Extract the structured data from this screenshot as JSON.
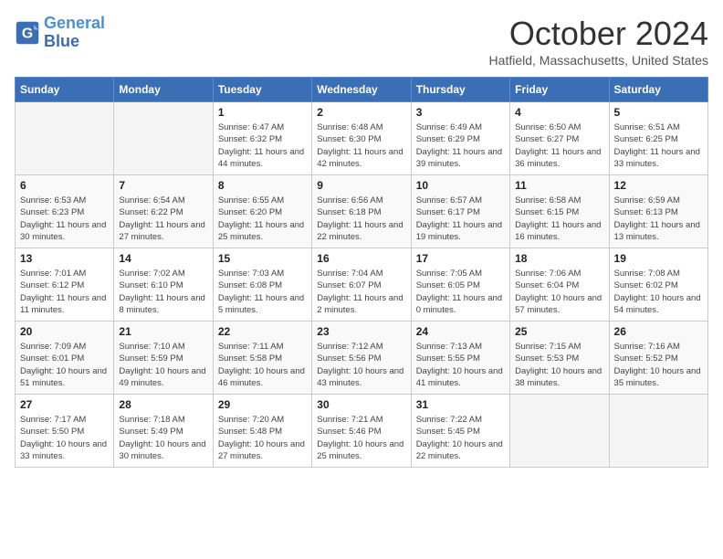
{
  "logo": {
    "line1": "General",
    "line2": "Blue"
  },
  "title": "October 2024",
  "location": "Hatfield, Massachusetts, United States",
  "weekdays": [
    "Sunday",
    "Monday",
    "Tuesday",
    "Wednesday",
    "Thursday",
    "Friday",
    "Saturday"
  ],
  "weeks": [
    [
      {
        "day": "",
        "content": ""
      },
      {
        "day": "",
        "content": ""
      },
      {
        "day": "1",
        "content": "Sunrise: 6:47 AM\nSunset: 6:32 PM\nDaylight: 11 hours and 44 minutes."
      },
      {
        "day": "2",
        "content": "Sunrise: 6:48 AM\nSunset: 6:30 PM\nDaylight: 11 hours and 42 minutes."
      },
      {
        "day": "3",
        "content": "Sunrise: 6:49 AM\nSunset: 6:29 PM\nDaylight: 11 hours and 39 minutes."
      },
      {
        "day": "4",
        "content": "Sunrise: 6:50 AM\nSunset: 6:27 PM\nDaylight: 11 hours and 36 minutes."
      },
      {
        "day": "5",
        "content": "Sunrise: 6:51 AM\nSunset: 6:25 PM\nDaylight: 11 hours and 33 minutes."
      }
    ],
    [
      {
        "day": "6",
        "content": "Sunrise: 6:53 AM\nSunset: 6:23 PM\nDaylight: 11 hours and 30 minutes."
      },
      {
        "day": "7",
        "content": "Sunrise: 6:54 AM\nSunset: 6:22 PM\nDaylight: 11 hours and 27 minutes."
      },
      {
        "day": "8",
        "content": "Sunrise: 6:55 AM\nSunset: 6:20 PM\nDaylight: 11 hours and 25 minutes."
      },
      {
        "day": "9",
        "content": "Sunrise: 6:56 AM\nSunset: 6:18 PM\nDaylight: 11 hours and 22 minutes."
      },
      {
        "day": "10",
        "content": "Sunrise: 6:57 AM\nSunset: 6:17 PM\nDaylight: 11 hours and 19 minutes."
      },
      {
        "day": "11",
        "content": "Sunrise: 6:58 AM\nSunset: 6:15 PM\nDaylight: 11 hours and 16 minutes."
      },
      {
        "day": "12",
        "content": "Sunrise: 6:59 AM\nSunset: 6:13 PM\nDaylight: 11 hours and 13 minutes."
      }
    ],
    [
      {
        "day": "13",
        "content": "Sunrise: 7:01 AM\nSunset: 6:12 PM\nDaylight: 11 hours and 11 minutes."
      },
      {
        "day": "14",
        "content": "Sunrise: 7:02 AM\nSunset: 6:10 PM\nDaylight: 11 hours and 8 minutes."
      },
      {
        "day": "15",
        "content": "Sunrise: 7:03 AM\nSunset: 6:08 PM\nDaylight: 11 hours and 5 minutes."
      },
      {
        "day": "16",
        "content": "Sunrise: 7:04 AM\nSunset: 6:07 PM\nDaylight: 11 hours and 2 minutes."
      },
      {
        "day": "17",
        "content": "Sunrise: 7:05 AM\nSunset: 6:05 PM\nDaylight: 11 hours and 0 minutes."
      },
      {
        "day": "18",
        "content": "Sunrise: 7:06 AM\nSunset: 6:04 PM\nDaylight: 10 hours and 57 minutes."
      },
      {
        "day": "19",
        "content": "Sunrise: 7:08 AM\nSunset: 6:02 PM\nDaylight: 10 hours and 54 minutes."
      }
    ],
    [
      {
        "day": "20",
        "content": "Sunrise: 7:09 AM\nSunset: 6:01 PM\nDaylight: 10 hours and 51 minutes."
      },
      {
        "day": "21",
        "content": "Sunrise: 7:10 AM\nSunset: 5:59 PM\nDaylight: 10 hours and 49 minutes."
      },
      {
        "day": "22",
        "content": "Sunrise: 7:11 AM\nSunset: 5:58 PM\nDaylight: 10 hours and 46 minutes."
      },
      {
        "day": "23",
        "content": "Sunrise: 7:12 AM\nSunset: 5:56 PM\nDaylight: 10 hours and 43 minutes."
      },
      {
        "day": "24",
        "content": "Sunrise: 7:13 AM\nSunset: 5:55 PM\nDaylight: 10 hours and 41 minutes."
      },
      {
        "day": "25",
        "content": "Sunrise: 7:15 AM\nSunset: 5:53 PM\nDaylight: 10 hours and 38 minutes."
      },
      {
        "day": "26",
        "content": "Sunrise: 7:16 AM\nSunset: 5:52 PM\nDaylight: 10 hours and 35 minutes."
      }
    ],
    [
      {
        "day": "27",
        "content": "Sunrise: 7:17 AM\nSunset: 5:50 PM\nDaylight: 10 hours and 33 minutes."
      },
      {
        "day": "28",
        "content": "Sunrise: 7:18 AM\nSunset: 5:49 PM\nDaylight: 10 hours and 30 minutes."
      },
      {
        "day": "29",
        "content": "Sunrise: 7:20 AM\nSunset: 5:48 PM\nDaylight: 10 hours and 27 minutes."
      },
      {
        "day": "30",
        "content": "Sunrise: 7:21 AM\nSunset: 5:46 PM\nDaylight: 10 hours and 25 minutes."
      },
      {
        "day": "31",
        "content": "Sunrise: 7:22 AM\nSunset: 5:45 PM\nDaylight: 10 hours and 22 minutes."
      },
      {
        "day": "",
        "content": ""
      },
      {
        "day": "",
        "content": ""
      }
    ]
  ]
}
